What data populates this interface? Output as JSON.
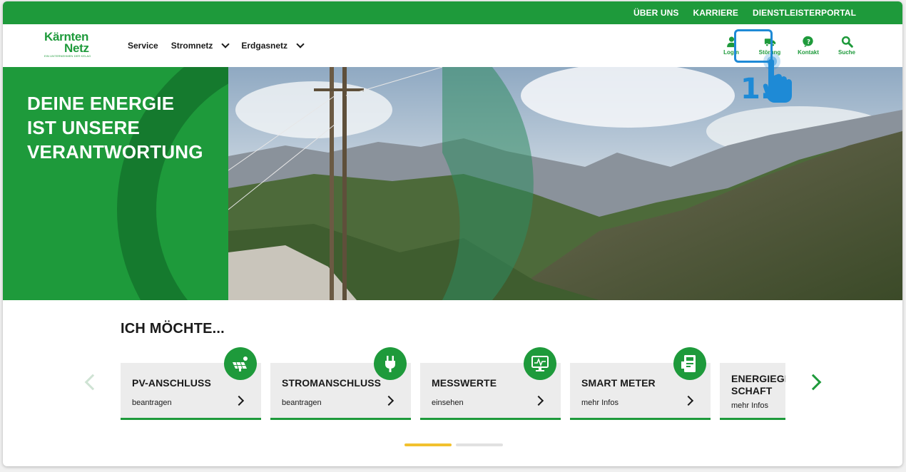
{
  "topbar": {
    "links": [
      "ÜBER UNS",
      "KARRIERE",
      "DIENSTLEISTERPORTAL"
    ]
  },
  "logo": {
    "line1": "Kärnten",
    "line2": "Netz",
    "tagline": "EIN UNTERNEHMEN DER KELAG"
  },
  "nav": {
    "items": [
      "Service",
      "Stromnetz",
      "Erdgasnetz"
    ]
  },
  "tools": {
    "login": "Login",
    "stoerung": "Störung",
    "kontakt": "Kontakt",
    "suche": "Suche"
  },
  "hero": {
    "title_lines": [
      "DEINE ENERGIE",
      "IST UNSERE",
      "VERANTWORTUNG"
    ]
  },
  "step_marker": "1.",
  "section": {
    "title": "ICH MÖCHTE..."
  },
  "cards": [
    {
      "title": "PV-ANSCHLUSS",
      "subtitle": "beantragen",
      "icon": "solar-panel-icon"
    },
    {
      "title": "STROMANSCHLUSS",
      "subtitle": "beantragen",
      "icon": "plug-icon"
    },
    {
      "title": "MESSWERTE",
      "subtitle": "einsehen",
      "icon": "monitor-chart-icon"
    },
    {
      "title": "SMART METER",
      "subtitle": "mehr Infos",
      "icon": "smart-meter-icon"
    },
    {
      "title": "ENERGIEGE SCHAFT",
      "subtitle": "mehr Infos",
      "icon": ""
    }
  ],
  "carousel": {
    "active_page": 1,
    "pages": 2
  },
  "colors": {
    "brand_green": "#1e9a3b",
    "highlight_blue": "#1e8ad6",
    "active_dot": "#f2c12e"
  }
}
